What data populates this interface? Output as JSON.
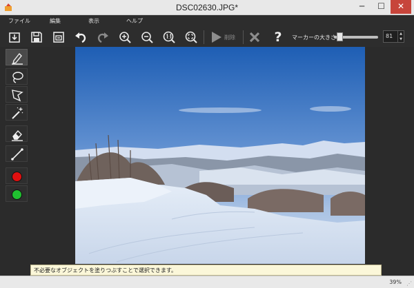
{
  "window": {
    "title": "DSC02630.JPG*",
    "min_glyph": "─",
    "max_glyph": "☐",
    "close_glyph": "✕"
  },
  "menu": [
    "ファイル",
    "編集",
    "表示",
    "ヘルプ"
  ],
  "toolbar": {
    "delete_label": "削除",
    "help_glyph": "?",
    "marker_size_label": "マーカーの大きさ",
    "marker_size_value": "81",
    "icons": [
      "open-icon",
      "save-icon",
      "save-as-icon",
      "undo-icon",
      "redo-icon",
      "zoom-in-icon",
      "zoom-out-icon",
      "zoom-actual-icon",
      "zoom-fit-icon",
      "play-icon",
      "cancel-icon",
      "help-icon"
    ]
  },
  "tools": [
    "marker-pen",
    "lasso",
    "polygon-lasso",
    "magic-wand",
    "eraser",
    "line",
    "red-color",
    "green-color"
  ],
  "colors": {
    "red": "#e01010",
    "green": "#20c030"
  },
  "hint": "不必要なオブジェクトを塗りつぶすことで選択できます。",
  "status": {
    "zoom": "39%"
  }
}
